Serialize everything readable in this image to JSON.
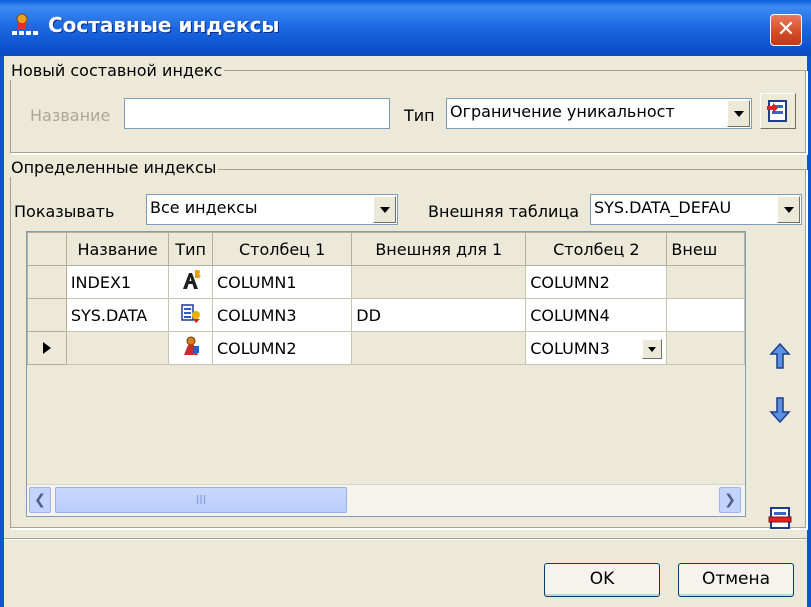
{
  "window": {
    "title": "Составные индексы",
    "close_glyph": "✕"
  },
  "new_index": {
    "group_label": "Новый составной индекс",
    "name_label": "Название",
    "name_value": "",
    "type_label": "Тип",
    "type_value": "Ограничение уникальност",
    "add_icon": "add-index-icon"
  },
  "defined": {
    "group_label": "Определенные индексы",
    "show_label": "Показывать",
    "show_value": "Все индексы",
    "ext_table_label": "Внешняя таблица",
    "ext_table_value": "SYS.DATA_DEFAU"
  },
  "grid": {
    "columns": [
      "Название",
      "Тип",
      "Столбец 1",
      "Внешняя для 1",
      "Столбец 2",
      "Внеш"
    ],
    "rows": [
      {
        "name": "INDEX1",
        "type_icon": "unique-constraint-icon",
        "col1": "COLUMN1",
        "ext1": "",
        "col2": "COLUMN2",
        "ext2": ""
      },
      {
        "name": "SYS.DATA",
        "type_icon": "foreign-key-icon",
        "col1": "COLUMN3",
        "ext1": "DD",
        "col2": "COLUMN4",
        "ext2": ""
      },
      {
        "name": "",
        "type_icon": "index-icon",
        "col1": "COLUMN2",
        "ext1": "",
        "col2": "COLUMN3",
        "ext2": "",
        "current": true
      }
    ],
    "scroll_thumb_grip": "III"
  },
  "side_buttons": [
    "move-up-icon",
    "move-down-icon",
    "delete-index-icon"
  ],
  "buttons": {
    "ok": "OK",
    "cancel": "Отмена"
  },
  "colors": {
    "titlebar": "#0E55D2",
    "window_bg": "#ECE9D8",
    "close": "#D44A25"
  }
}
